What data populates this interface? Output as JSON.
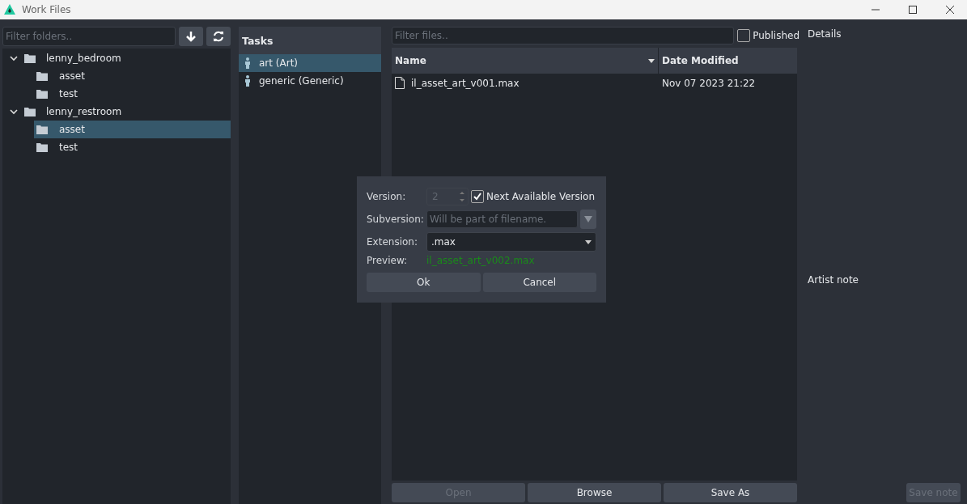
{
  "window": {
    "title": "Work Files"
  },
  "folders": {
    "filter_placeholder": "Filter folders..",
    "tree": [
      {
        "label": "lenny_bedroom",
        "expanded": true,
        "selected": false,
        "children": [
          {
            "label": "asset",
            "selected": false
          },
          {
            "label": "test",
            "selected": false
          }
        ]
      },
      {
        "label": "lenny_restroom",
        "expanded": true,
        "selected": false,
        "children": [
          {
            "label": "asset",
            "selected": true
          },
          {
            "label": "test",
            "selected": false
          }
        ]
      }
    ]
  },
  "tasks": {
    "header": "Tasks",
    "items": [
      {
        "label": "art (Art)",
        "selected": true
      },
      {
        "label": "generic (Generic)",
        "selected": false
      }
    ]
  },
  "files": {
    "filter_placeholder": "Filter files..",
    "published": {
      "label": "Published",
      "checked": false
    },
    "columns": [
      {
        "label": "Name",
        "sorted": true
      },
      {
        "label": "Date Modified",
        "sorted": false
      }
    ],
    "rows": [
      {
        "name": "il_asset_art_v001.max",
        "date": "Nov 07 2023 21:22",
        "selected": false
      }
    ],
    "buttons": [
      {
        "label": "Open",
        "disabled": true
      },
      {
        "label": "Browse",
        "disabled": false
      },
      {
        "label": "Save As",
        "disabled": false
      }
    ]
  },
  "details": {
    "title": "Details",
    "artist_note": "Artist note",
    "save_note": {
      "label": "Save note",
      "disabled": true
    }
  },
  "dialog": {
    "version_label": "Version:",
    "version_value": "2",
    "version_disabled": true,
    "next_version": {
      "label": "Next Available Version",
      "checked": true
    },
    "subversion_label": "Subversion:",
    "subversion_placeholder": "Will be part of filename.",
    "extension_label": "Extension:",
    "extension_value": ".max",
    "preview_label": "Preview:",
    "preview_value": "il_asset_art_v002.max",
    "buttons": [
      {
        "label": "Ok"
      },
      {
        "label": "Cancel"
      }
    ]
  }
}
